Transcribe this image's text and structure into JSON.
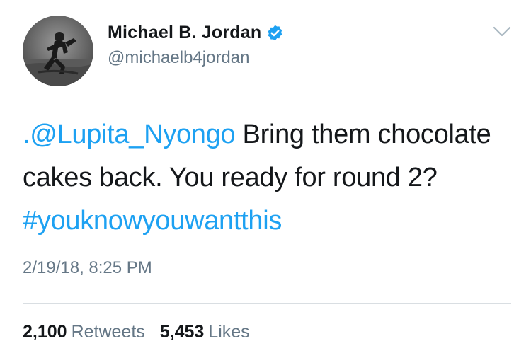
{
  "user": {
    "display_name": "Michael B. Jordan",
    "handle": "@michaelb4jordan",
    "verified": true,
    "avatar_icon": "profile-photo-boxer-grayscale"
  },
  "tweet": {
    "mention": ".@Lupita_Nyongo",
    "text_1": " Bring them chocolate cakes back. You ready for round 2? ",
    "hashtag": "#youknowyouwantthis",
    "timestamp": "2/19/18, 8:25 PM"
  },
  "stats": {
    "retweets_count": "2,100",
    "retweets_label": "Retweets",
    "likes_count": "5,453",
    "likes_label": "Likes"
  },
  "icons": {
    "verified": "verified-badge-icon",
    "menu": "chevron-down-icon"
  },
  "colors": {
    "link": "#1da1f2",
    "secondary_text": "#657786",
    "primary_text": "#14171a",
    "verified_badge": "#1da1f2"
  }
}
